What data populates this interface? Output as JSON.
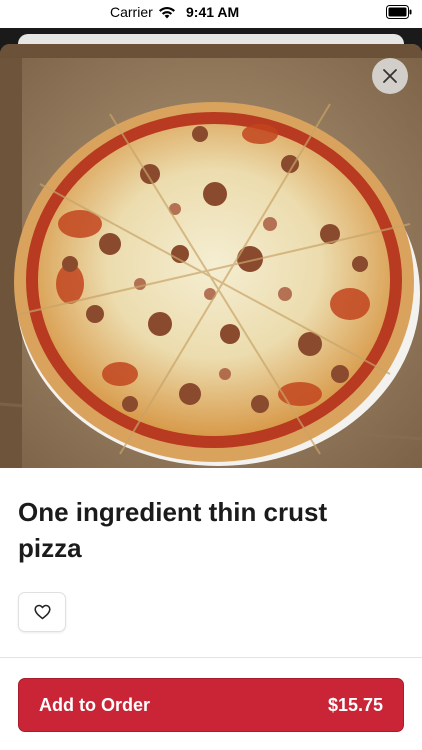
{
  "status_bar": {
    "carrier": "Carrier",
    "time": "9:41 AM"
  },
  "item": {
    "title": "One ingredient thin crust pizza",
    "image": "pizza-photo"
  },
  "actions": {
    "add_label": "Add to Order",
    "price": "$15.75"
  },
  "icons": {
    "close": "close-icon",
    "favorite": "heart-icon",
    "wifi": "wifi-icon",
    "battery": "battery-icon"
  },
  "colors": {
    "accent": "#c92537",
    "text": "#1b1b1b"
  }
}
